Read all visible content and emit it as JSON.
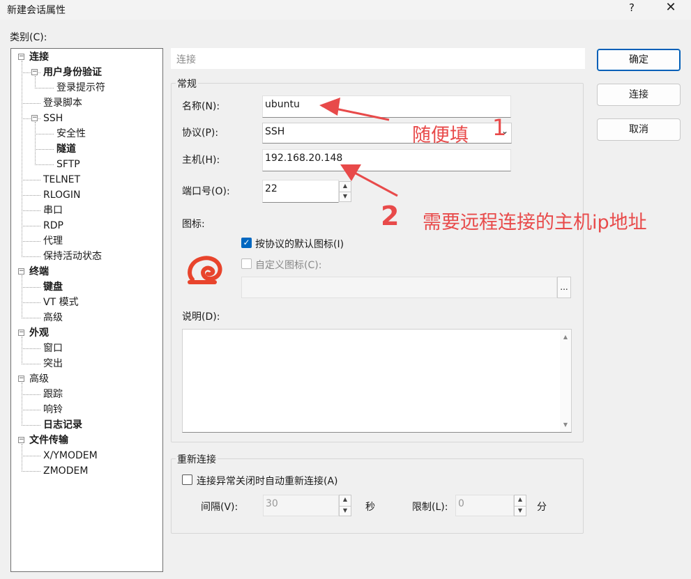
{
  "window": {
    "title": "新建会话属性",
    "help_label": "?",
    "close_label": "✕"
  },
  "category_label": "类别(C):",
  "tree": [
    {
      "label": "连接",
      "bold": true,
      "expander": "−"
    },
    {
      "label": "用户身份验证",
      "bold": true,
      "expander": "−"
    },
    {
      "label": "登录提示符"
    },
    {
      "label": "登录脚本"
    },
    {
      "label": "SSH",
      "expander": "−"
    },
    {
      "label": "安全性"
    },
    {
      "label": "隧道",
      "bold": true
    },
    {
      "label": "SFTP"
    },
    {
      "label": "TELNET"
    },
    {
      "label": "RLOGIN"
    },
    {
      "label": "串口"
    },
    {
      "label": "RDP"
    },
    {
      "label": "代理"
    },
    {
      "label": "保持活动状态"
    },
    {
      "label": "终端",
      "bold": true,
      "expander": "−"
    },
    {
      "label": "键盘",
      "bold": true
    },
    {
      "label": "VT 模式"
    },
    {
      "label": "高级"
    },
    {
      "label": "外观",
      "bold": true,
      "expander": "−"
    },
    {
      "label": "窗口"
    },
    {
      "label": "突出"
    },
    {
      "label": "高级",
      "expander": "−"
    },
    {
      "label": "跟踪"
    },
    {
      "label": "响铃"
    },
    {
      "label": "日志记录",
      "bold": true
    },
    {
      "label": "文件传输",
      "bold": true,
      "expander": "−"
    },
    {
      "label": "X/YMODEM"
    },
    {
      "label": "ZMODEM"
    }
  ],
  "header_box": "连接",
  "general": {
    "legend": "常规",
    "name_label": "名称(N):",
    "name_value": "ubuntu",
    "protocol_label": "协议(P):",
    "protocol_value": "SSH",
    "host_label": "主机(H):",
    "host_value": "192.168.20.148",
    "port_label": "端口号(O):",
    "port_value": "22",
    "icon_label": "图标:",
    "default_icon_label": "按协议的默认图标(I)",
    "custom_icon_label": "自定义图标(C):",
    "browse_label": "...",
    "desc_label": "说明(D):",
    "desc_value": ""
  },
  "reconnect": {
    "legend": "重新连接",
    "auto_label": "连接异常关闭时自动重新连接(A)",
    "interval_label": "间隔(V):",
    "interval_value": "30",
    "interval_unit": "秒",
    "limit_label": "限制(L):",
    "limit_value": "0",
    "limit_unit": "分"
  },
  "buttons": {
    "ok": "确定",
    "connect": "连接",
    "cancel": "取消"
  },
  "annotations": {
    "note1": "随便填",
    "num1": "1",
    "note2": "需要远程连接的主机ip地址",
    "num2": "2"
  },
  "colors": {
    "accent": "#0067c0",
    "annotation": "#e84a4a",
    "icon": "#e8442c"
  }
}
